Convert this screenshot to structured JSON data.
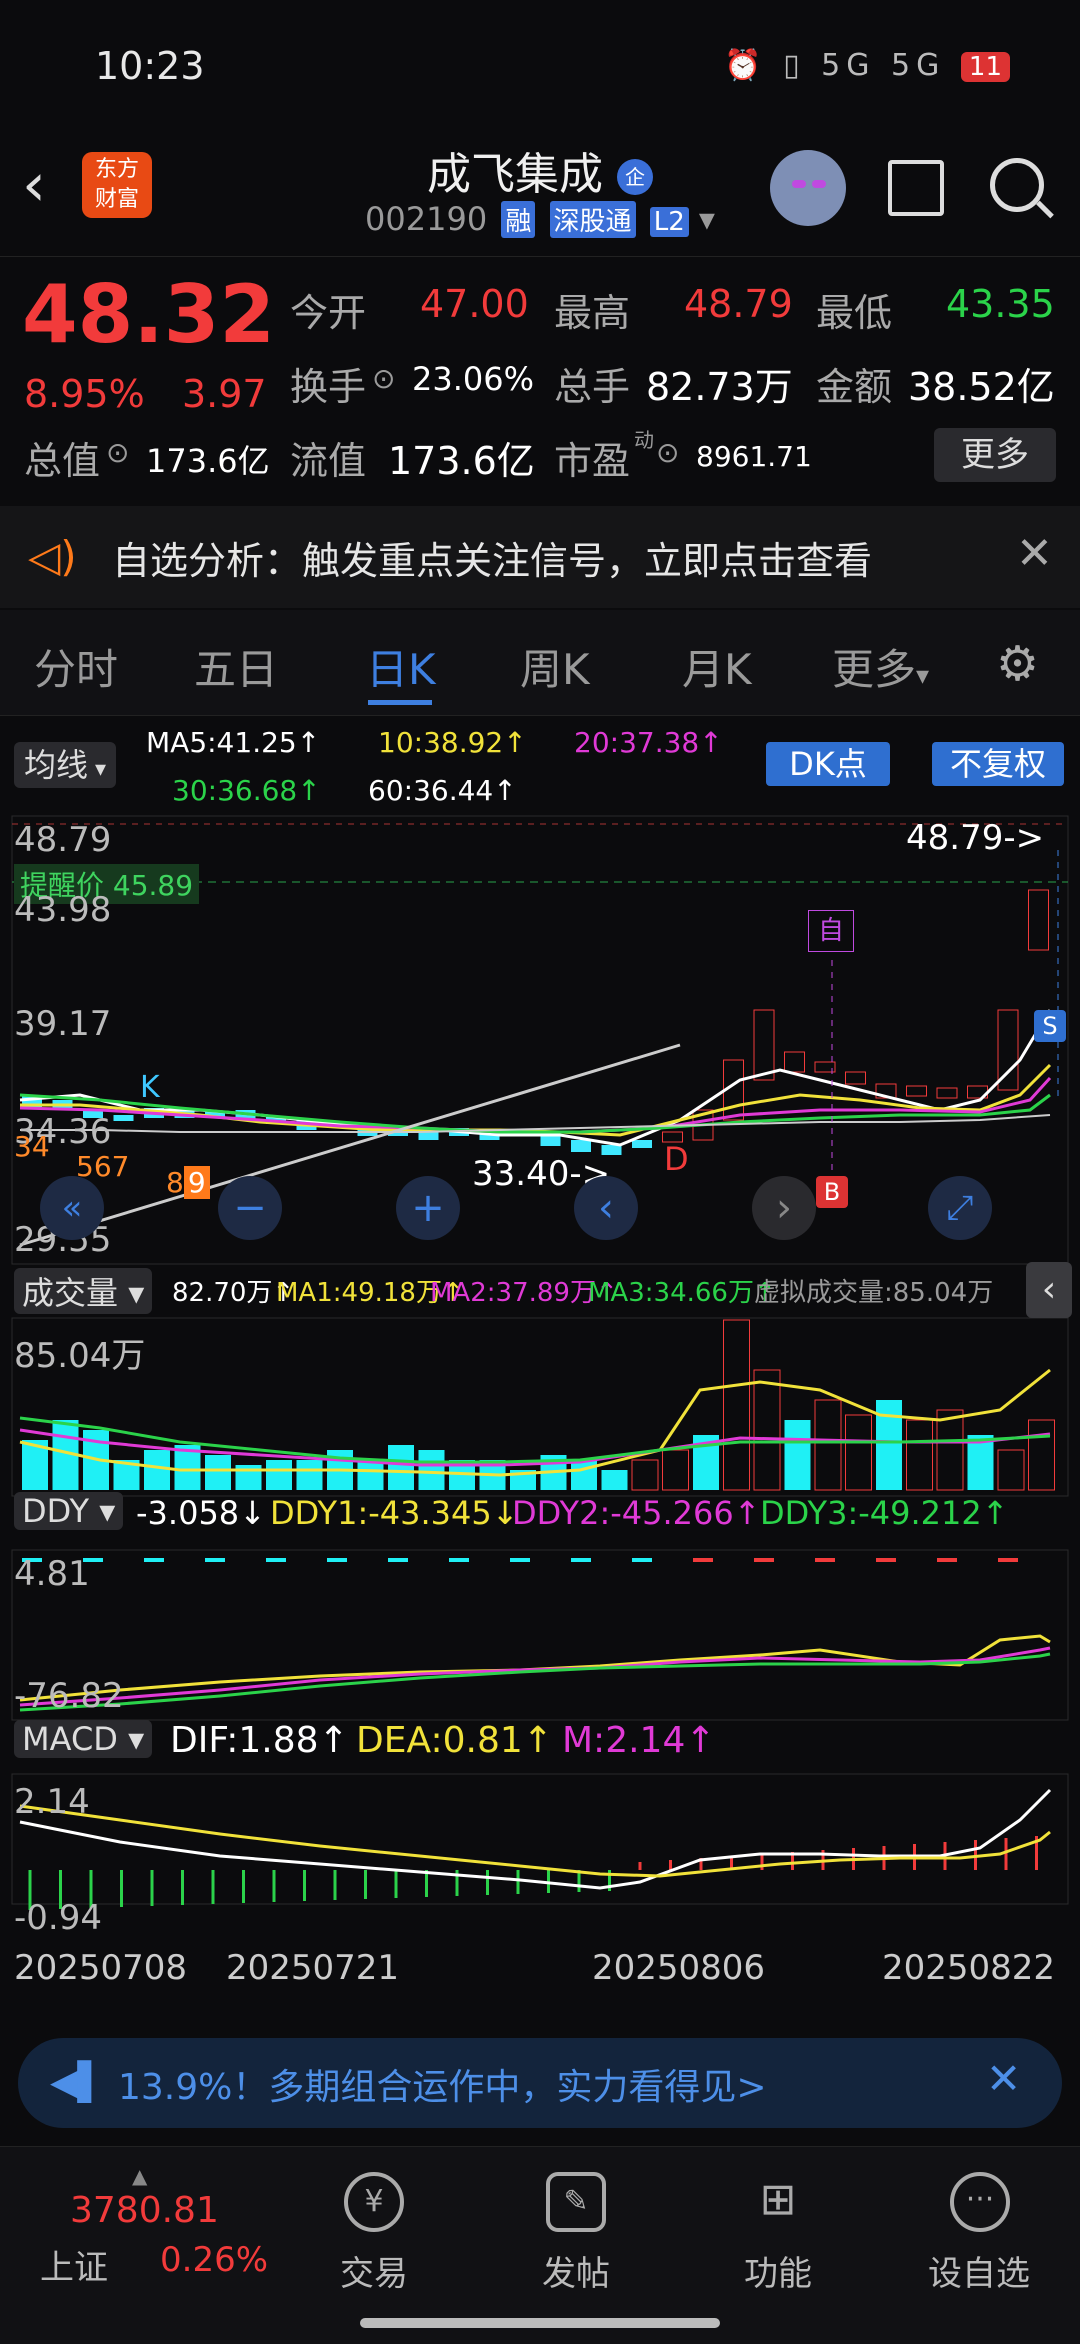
{
  "status": {
    "time": "10:23",
    "signal1": "5G",
    "signal2": "5G",
    "battery": "11"
  },
  "header": {
    "app_logo": "东方\n财富",
    "logo_line1": "东方",
    "logo_line2": "财富",
    "stock_name": "成飞集成",
    "badge": "企",
    "code": "002190",
    "tags": [
      "融",
      "深股通",
      "L2"
    ]
  },
  "quote": {
    "price": "48.32",
    "pct": "8.95%",
    "change": "3.97",
    "open_label": "今开",
    "open": "47.00",
    "high_label": "最高",
    "high": "48.79",
    "low_label": "最低",
    "low": "43.35",
    "turnover_label": "换手",
    "turnover": "23.06%",
    "volume_label": "总手",
    "volume": "82.73万",
    "amount_label": "金额",
    "amount": "38.52亿",
    "mktcap_label": "总值",
    "mktcap": "173.6亿",
    "float_label": "流值",
    "float": "173.6亿",
    "pe_label": "市盈",
    "pe_sup": "动",
    "pe": "8961.71",
    "more": "更多"
  },
  "alert": {
    "text": "自选分析：触发重点关注信号，立即点击查看"
  },
  "tabs": [
    "分时",
    "五日",
    "日K",
    "周K",
    "月K",
    "更多"
  ],
  "ma": {
    "label": "均线",
    "ma5": "MA5:41.25↑",
    "ma10": "10:38.92↑",
    "ma20": "20:37.38↑",
    "ma30": "30:36.68↑",
    "ma60": "60:36.44↑",
    "dk": "DK点",
    "fq": "不复权"
  },
  "kline": {
    "y_labels": [
      "48.79",
      "43.98",
      "39.17",
      "34.36",
      "29.55"
    ],
    "alert_price": "提醒价 45.89",
    "high_marker": "48.79->",
    "low_marker": "33.40->",
    "mark_k": "K",
    "mark_d": "D",
    "mark_self": "自",
    "mark_b": "B",
    "mark_s": "S",
    "counts": [
      "3",
      "4",
      "5",
      "6",
      "7",
      "8",
      "9"
    ]
  },
  "volume": {
    "label": "成交量",
    "v": "82.70万↑",
    "ma1": "MA1:49.18万↑",
    "ma2": "MA2:37.89万↑",
    "ma3": "MA3:34.66万↑",
    "virtual": "虚拟成交量:85.04万",
    "max": "85.04万"
  },
  "ddy": {
    "label": "DDY",
    "v": "-3.058↓",
    "d1": "DDY1:-43.345↓",
    "d2": "DDY2:-45.266↑",
    "d3": "DDY3:-49.212↑",
    "top": "4.81",
    "bottom": "-76.82"
  },
  "macd": {
    "label": "MACD",
    "dif": "DIF:1.88↑",
    "dea": "DEA:0.81↑",
    "m": "M:2.14↑",
    "top": "2.14",
    "bottom": "-0.94"
  },
  "dates": [
    "20250708",
    "20250721",
    "20250806",
    "20250822"
  ],
  "banner": {
    "text": "13.9%！多期组合运作中，实力看得见>"
  },
  "index": {
    "value": "3780.81",
    "name": "上证",
    "pct": "0.26%"
  },
  "nav": [
    "交易",
    "发帖",
    "功能",
    "设自选"
  ]
}
